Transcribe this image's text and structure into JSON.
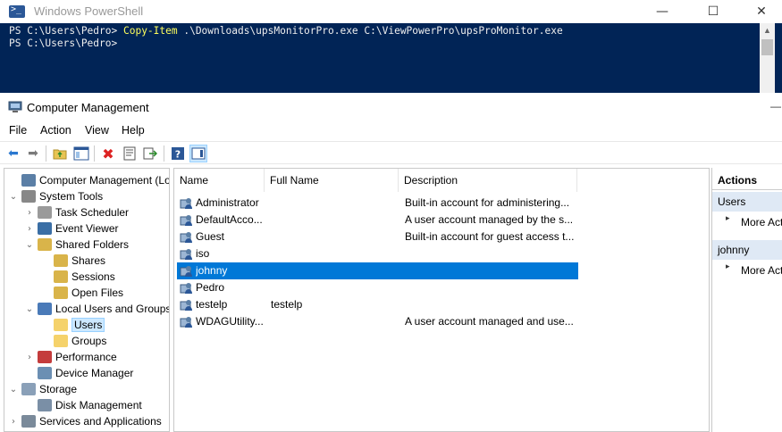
{
  "powershell": {
    "title": "Windows PowerShell",
    "lines": [
      {
        "prompt": "PS C:\\Users\\Pedro> ",
        "command": "Copy-Item",
        "args": " .\\Downloads\\upsMonitorPro.exe C:\\ViewPowerPro\\upsProMonitor.exe"
      },
      {
        "prompt": "PS C:\\Users\\Pedro>",
        "command": "",
        "args": ""
      }
    ],
    "controls": {
      "minimize": "—",
      "maximize": "☐",
      "close": "✕"
    }
  },
  "cm": {
    "title": "Computer Management",
    "menu": [
      "File",
      "Action",
      "View",
      "Help"
    ],
    "toolbar_icons": [
      "back-arrow-icon",
      "forward-arrow-icon",
      "up-folder-icon",
      "show-hide-tree-icon",
      "delete-icon",
      "properties-icon",
      "export-list-icon",
      "help-icon",
      "show-hide-action-pane-icon"
    ],
    "tree": [
      {
        "label": "Computer Management (Local",
        "level": 0,
        "twisty": "",
        "icon": "computer-management-icon",
        "color": "#5b7fa6"
      },
      {
        "label": "System Tools",
        "level": 0,
        "twisty": "⌄",
        "icon": "system-tools-icon",
        "color": "#888888"
      },
      {
        "label": "Task Scheduler",
        "level": 1,
        "twisty": "›",
        "icon": "clock-icon",
        "color": "#9a9a9a"
      },
      {
        "label": "Event Viewer",
        "level": 1,
        "twisty": "›",
        "icon": "event-viewer-icon",
        "color": "#3a6ea5"
      },
      {
        "label": "Shared Folders",
        "level": 1,
        "twisty": "⌄",
        "icon": "shared-folder-icon",
        "color": "#d9b44a"
      },
      {
        "label": "Shares",
        "level": 2,
        "twisty": "",
        "icon": "shared-folder-icon",
        "color": "#d9b44a"
      },
      {
        "label": "Sessions",
        "level": 2,
        "twisty": "",
        "icon": "shared-folder-icon",
        "color": "#d9b44a"
      },
      {
        "label": "Open Files",
        "level": 2,
        "twisty": "",
        "icon": "shared-folder-icon",
        "color": "#d9b44a"
      },
      {
        "label": "Local Users and Groups",
        "level": 1,
        "twisty": "⌄",
        "icon": "users-groups-icon",
        "color": "#4a7ab8"
      },
      {
        "label": "Users",
        "level": 2,
        "twisty": "",
        "icon": "folder-icon",
        "color": "#f5d26b",
        "selected": true
      },
      {
        "label": "Groups",
        "level": 2,
        "twisty": "",
        "icon": "folder-icon",
        "color": "#f5d26b"
      },
      {
        "label": "Performance",
        "level": 1,
        "twisty": "›",
        "icon": "performance-icon",
        "color": "#c43c3c"
      },
      {
        "label": "Device Manager",
        "level": 1,
        "twisty": "",
        "icon": "device-manager-icon",
        "color": "#6b8fb3"
      },
      {
        "label": "Storage",
        "level": 0,
        "twisty": "⌄",
        "icon": "storage-icon",
        "color": "#8aa0b8"
      },
      {
        "label": "Disk Management",
        "level": 1,
        "twisty": "",
        "icon": "disk-icon",
        "color": "#7a8fa6"
      },
      {
        "label": "Services and Applications",
        "level": 0,
        "twisty": "›",
        "icon": "services-icon",
        "color": "#7a8a9a"
      }
    ],
    "columns": [
      "Name",
      "Full Name",
      "Description"
    ],
    "users": [
      {
        "name": "Administrator",
        "full_name": "",
        "description": "Built-in account for administering..."
      },
      {
        "name": "DefaultAcco...",
        "full_name": "",
        "description": "A user account managed by the s..."
      },
      {
        "name": "Guest",
        "full_name": "",
        "description": "Built-in account for guest access t..."
      },
      {
        "name": "iso",
        "full_name": "",
        "description": ""
      },
      {
        "name": "johnny",
        "full_name": "",
        "description": "",
        "selected": true
      },
      {
        "name": "Pedro",
        "full_name": "",
        "description": ""
      },
      {
        "name": "testelp",
        "full_name": "testelp",
        "description": ""
      },
      {
        "name": "WDAGUtility...",
        "full_name": "",
        "description": "A user account managed and use..."
      }
    ],
    "actions": {
      "title": "Actions",
      "groups": [
        {
          "header": "Users",
          "item": "More Act"
        },
        {
          "header": "johnny",
          "item": "More Act"
        }
      ]
    },
    "colors": {
      "selection": "#0078d7",
      "tree_selection": "#cce8ff",
      "action_header": "#dfe9f5",
      "console_bg": "#012456",
      "command": "#ffff5c"
    }
  }
}
